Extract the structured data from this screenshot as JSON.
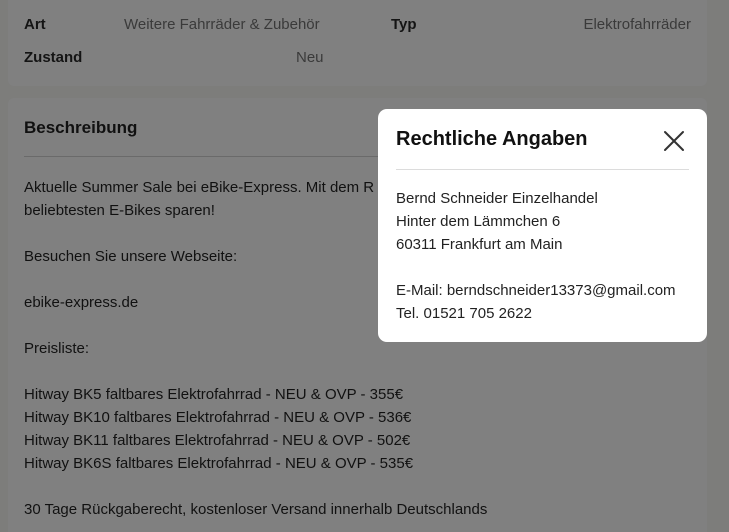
{
  "details": {
    "art_label": "Art",
    "art_value": "Weitere Fahrräder & Zubehör",
    "typ_label": "Typ",
    "typ_value": "Elektrofahrräder",
    "zustand_label": "Zustand",
    "zustand_value": "Neu"
  },
  "description": {
    "title": "Beschreibung",
    "line1": "Aktuelle Summer Sale bei eBike-Express. Mit dem R",
    "line2": "beliebtesten E-Bikes sparen!",
    "line3": "Besuchen Sie unsere Webseite:",
    "line4": "ebike-express.de",
    "line5": "Preisliste:",
    "prices": [
      "Hitway BK5 faltbares Elektrofahrrad - NEU & OVP - 355€",
      "Hitway BK10 faltbares Elektrofahrrad - NEU & OVP - 536€",
      "Hitway BK11 faltbares Elektrofahrrad - NEU & OVP - 502€",
      "Hitway BK6S faltbares Elektrofahrrad - NEU & OVP - 535€"
    ],
    "line6": "30 Tage Rückgaberecht, kostenloser Versand innerhalb Deutschlands"
  },
  "modal": {
    "title": "Rechtliche Angaben",
    "close_icon": "close-icon",
    "name": "Bernd Schneider Einzelhandel",
    "street": "Hinter dem Lämmchen 6",
    "city": "60311 Frankfurt am Main",
    "email": "E-Mail: berndschneider13373@gmail.com",
    "phone": "Tel. 01521 705 2622"
  }
}
